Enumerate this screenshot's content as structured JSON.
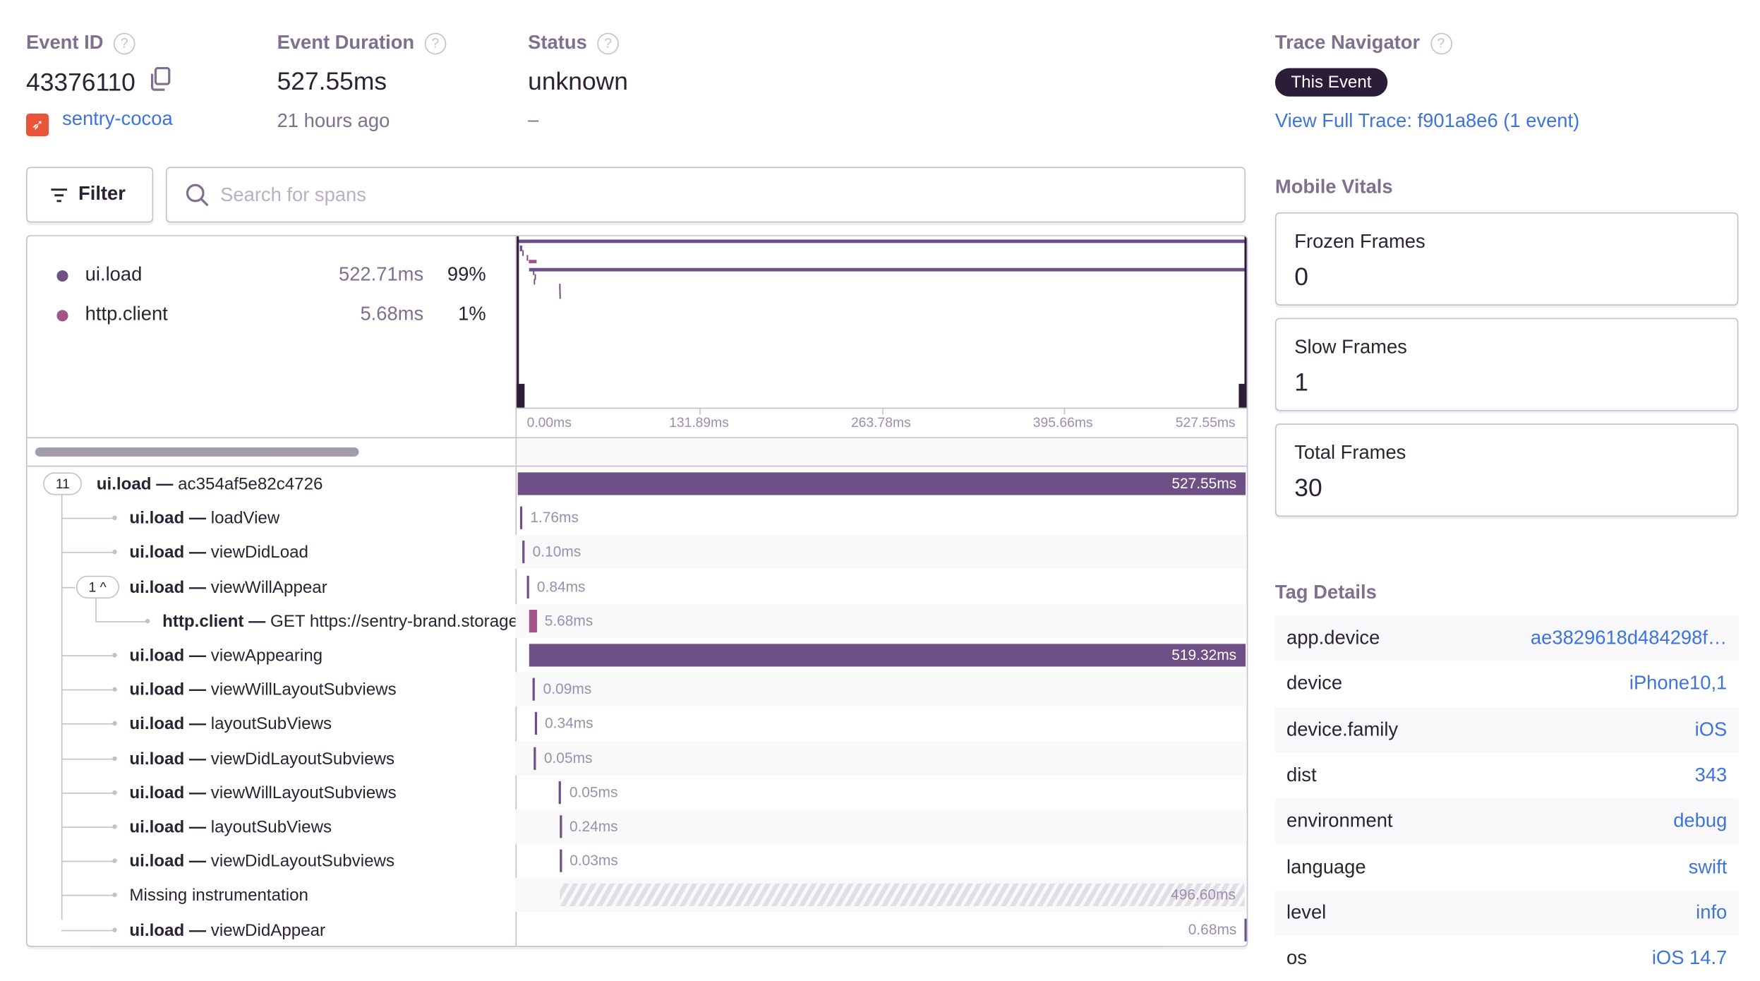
{
  "header": {
    "event_id": {
      "label": "Event ID",
      "value": "43376110",
      "project": "sentry-cocoa"
    },
    "duration": {
      "label": "Event Duration",
      "value": "527.55ms",
      "sub": "21 hours ago"
    },
    "status": {
      "label": "Status",
      "value": "unknown",
      "sub": "–"
    },
    "help_glyph": "?"
  },
  "trace_navigator": {
    "title": "Trace Navigator",
    "pill": "This Event",
    "link": "View Full Trace: f901a8e6 (1 event)"
  },
  "mobile_vitals": {
    "title": "Mobile Vitals",
    "cards": [
      {
        "label": "Frozen Frames",
        "value": "0"
      },
      {
        "label": "Slow Frames",
        "value": "1"
      },
      {
        "label": "Total Frames",
        "value": "30"
      }
    ]
  },
  "tag_details": {
    "title": "Tag Details",
    "rows": [
      {
        "key": "app.device",
        "value": "ae3829618d484298f…"
      },
      {
        "key": "device",
        "value": "iPhone10,1"
      },
      {
        "key": "device.family",
        "value": "iOS"
      },
      {
        "key": "dist",
        "value": "343"
      },
      {
        "key": "environment",
        "value": "debug"
      },
      {
        "key": "language",
        "value": "swift"
      },
      {
        "key": "level",
        "value": "info"
      },
      {
        "key": "os",
        "value": "iOS 14.7"
      }
    ]
  },
  "toolbar": {
    "filter_label": "Filter",
    "search_placeholder": "Search for spans"
  },
  "colors": {
    "ui_load": "#6e5086",
    "http_client": "#a35488",
    "link": "#3d74db",
    "missing": "#e2dee6"
  },
  "ops_breakdown": [
    {
      "op": "ui.load",
      "duration": "522.71ms",
      "percent": "99%",
      "color": "#6e5086"
    },
    {
      "op": "http.client",
      "duration": "5.68ms",
      "percent": "1%",
      "color": "#a35488"
    }
  ],
  "time_axis": {
    "min_ms": 0,
    "max_ms": 527.55,
    "ticks": [
      "0.00ms",
      "131.89ms",
      "263.78ms",
      "395.66ms",
      "527.55ms"
    ]
  },
  "spans": [
    {
      "op": "ui.load",
      "desc": "ac354af5e82c4726",
      "duration": "527.55ms",
      "start_ms": 0,
      "depth": 0,
      "children_count": "11"
    },
    {
      "op": "ui.load",
      "desc": "loadView",
      "duration": "1.76ms",
      "start_ms": 1.5,
      "depth": 1
    },
    {
      "op": "ui.load",
      "desc": "viewDidLoad",
      "duration": "0.10ms",
      "start_ms": 3.3,
      "depth": 1
    },
    {
      "op": "ui.load",
      "desc": "viewWillAppear",
      "duration": "0.84ms",
      "start_ms": 6.5,
      "depth": 1,
      "children_count": "1 ^"
    },
    {
      "op": "http.client",
      "desc": "GET https://sentry-brand.storage.googleapis.com",
      "duration": "5.68ms",
      "start_ms": 8.0,
      "depth": 2
    },
    {
      "op": "ui.load",
      "desc": "viewAppearing",
      "duration": "519.32ms",
      "start_ms": 8.2,
      "depth": 1
    },
    {
      "op": "ui.load",
      "desc": "viewWillLayoutSubviews",
      "duration": "0.09ms",
      "start_ms": 11.0,
      "depth": 1
    },
    {
      "op": "ui.load",
      "desc": "layoutSubViews",
      "duration": "0.34ms",
      "start_ms": 12.2,
      "depth": 1
    },
    {
      "op": "ui.load",
      "desc": "viewDidLayoutSubviews",
      "duration": "0.05ms",
      "start_ms": 11.6,
      "depth": 1
    },
    {
      "op": "ui.load",
      "desc": "viewWillLayoutSubviews",
      "duration": "0.05ms",
      "start_ms": 30.0,
      "depth": 1
    },
    {
      "op": "ui.load",
      "desc": "layoutSubViews",
      "duration": "0.24ms",
      "start_ms": 30.1,
      "depth": 1
    },
    {
      "op": "ui.load",
      "desc": "viewDidLayoutSubviews",
      "duration": "0.03ms",
      "start_ms": 30.2,
      "depth": 1
    },
    {
      "op": null,
      "desc": "Missing instrumentation",
      "duration": "496.60ms",
      "start_ms": 30.3,
      "depth": 1,
      "missing": true
    },
    {
      "op": "ui.load",
      "desc": "viewDidAppear",
      "duration": "0.68ms",
      "start_ms": 526.8,
      "depth": 1
    }
  ]
}
